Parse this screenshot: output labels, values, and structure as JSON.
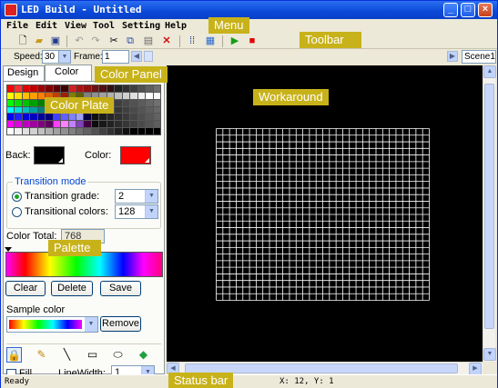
{
  "window": {
    "title": "LED Build - Untitled",
    "min_icon": "minimize-icon",
    "max_icon": "maximize-icon",
    "close_icon": "close-icon"
  },
  "menu": {
    "items": [
      "File",
      "Edit",
      "View",
      "Tool",
      "Setting",
      "Help"
    ]
  },
  "toolbar": {
    "icons": [
      "new-file-icon",
      "open-folder-icon",
      "save-icon",
      "undo-icon",
      "redo-icon",
      "cut-icon",
      "copy-icon",
      "paste-icon",
      "delete-icon",
      "grid-icon",
      "settings-icon",
      "play-icon",
      "stop-icon"
    ]
  },
  "speedbar": {
    "speed_label": "Speed:",
    "speed_value": "30",
    "frame_label": "Frame:",
    "frame_value": "1",
    "scene_value": "Scene1"
  },
  "panel": {
    "tabs": [
      "Design",
      "Color"
    ],
    "active_tab": "Color",
    "back_label": "Back:",
    "back_color": "#000000",
    "color_label": "Color:",
    "color_color": "#ff0000",
    "transition": {
      "title": "Transition mode",
      "grade_label": "Transition grade:",
      "grade_value": "2",
      "colors_label": "Transitional colors:",
      "colors_value": "128",
      "selected": "grade"
    },
    "color_total_label": "Color Total:",
    "color_total_value": "768",
    "buttons": {
      "clear": "Clear",
      "delete": "Delete",
      "save": "Save"
    },
    "sample_label": "Sample color",
    "remove_button": "Remove",
    "fill_label": "Fill",
    "linewidth_label": "LineWidth:",
    "linewidth_value": "1",
    "tools": [
      "lock-icon",
      "pencil-icon",
      "line-icon",
      "rectangle-icon",
      "ellipse-icon",
      "fill-bucket-icon"
    ]
  },
  "status": {
    "left": "Ready",
    "coords": "X: 12, Y: 1"
  },
  "annotations": {
    "menu": "Menu",
    "toolbar": "Toolbar",
    "color_panel": "Color Panel",
    "color_plate": "Color Plate",
    "workaround": "Workaround",
    "palette": "Palette",
    "status_bar": "Status bar"
  },
  "colors": {
    "accent": "#0a48d6",
    "annotation": "#c8b21a",
    "workarea": "#000000"
  }
}
